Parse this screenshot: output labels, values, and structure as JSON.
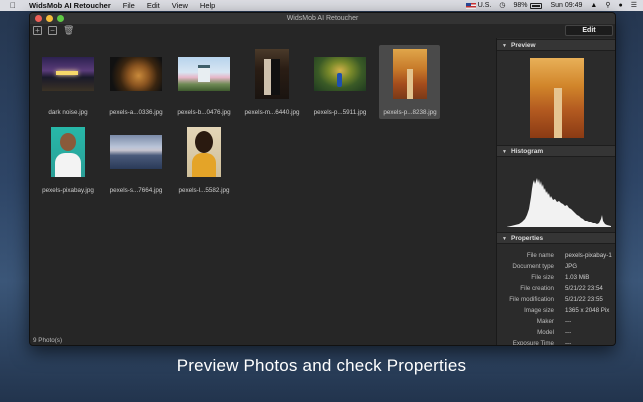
{
  "menubar": {
    "app_name": "WidsMob AI Retoucher",
    "items": [
      "File",
      "Edit",
      "View",
      "Help"
    ],
    "input_source": "U.S.",
    "battery": "98%",
    "clock": "Sun 09:49"
  },
  "window": {
    "title": "WidsMob AI Retoucher",
    "edit_label": "Edit",
    "status": "9 Photo(s)"
  },
  "thumbnails": [
    {
      "label": "dark noise.jpg"
    },
    {
      "label": "pexels-a...0336.jpg"
    },
    {
      "label": "pexels-b...0476.jpg"
    },
    {
      "label": "pexels-m...6440.jpg"
    },
    {
      "label": "pexels-p...5911.jpg"
    },
    {
      "label": "pexels-p...8238.jpg"
    },
    {
      "label": "pexels-pixabay.jpg"
    },
    {
      "label": "pexels-s...7664.jpg"
    },
    {
      "label": "pexels-l...5582.jpg"
    }
  ],
  "panel": {
    "preview_title": "Preview",
    "histogram_title": "Histogram",
    "properties_title": "Properties",
    "properties": [
      {
        "key": "File name",
        "value": "pexels-pixabay-1"
      },
      {
        "key": "Document type",
        "value": "JPG"
      },
      {
        "key": "File size",
        "value": "1.03 MiB"
      },
      {
        "key": "File creation",
        "value": "5/21/22 23:54"
      },
      {
        "key": "File modification",
        "value": "5/21/22 23:55"
      },
      {
        "key": "Image size",
        "value": "1365 x 2048 Pix"
      },
      {
        "key": "Maker",
        "value": "---"
      },
      {
        "key": "Model",
        "value": "---"
      },
      {
        "key": "Exposure Time",
        "value": "---"
      }
    ]
  },
  "caption": "Preview Photos and check Properties",
  "colors": {
    "selection": "#4a4a4a",
    "panel_header": "#353535"
  }
}
